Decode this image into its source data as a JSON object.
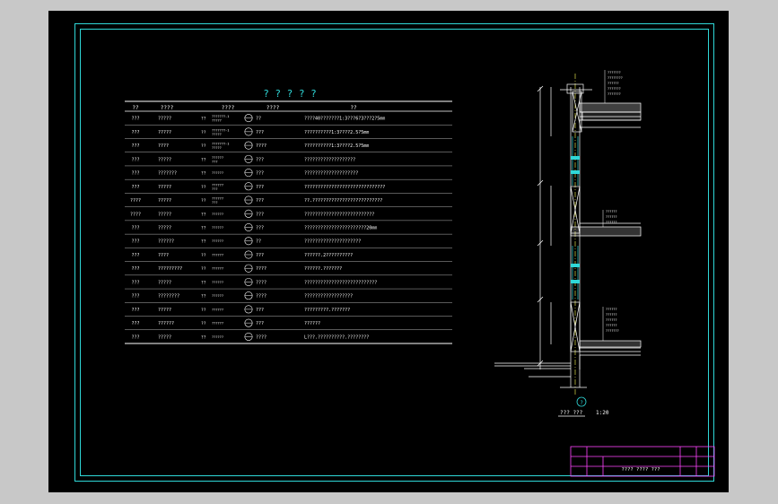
{
  "table": {
    "title": "? ? ? ? ?",
    "headers": [
      "??",
      "????",
      "????",
      "????",
      "??"
    ],
    "rows": [
      {
        "col1": "???",
        "col2": "?????",
        "code_prefix": "??",
        "ref_top": "???????-1",
        "ref_bot": "?????",
        "mark": "??",
        "desc": "????40???????1:3???6?3???2?5mm"
      },
      {
        "col1": "???",
        "col2": "?????",
        "code_prefix": "??",
        "ref_top": "???????-1",
        "ref_bot": "?????",
        "mark": "???",
        "desc": "??????????1:3????2.5?5mm"
      },
      {
        "col1": "???",
        "col2": "????",
        "code_prefix": "??",
        "ref_top": "???????-1",
        "ref_bot": "?????",
        "mark": "????",
        "desc": "??????????1:3????2.5?5mm"
      },
      {
        "col1": "???",
        "col2": "?????",
        "code_prefix": "??",
        "ref_top": "??????",
        "ref_bot": "???",
        "mark": "???",
        "desc": "???????????????????"
      },
      {
        "col1": "???",
        "col2": "???????",
        "code_prefix": "??",
        "ref_top": "??????",
        "ref_bot": "",
        "mark": "???",
        "desc": "????????????????????"
      },
      {
        "col1": "???",
        "col2": "?????",
        "code_prefix": "??",
        "ref_top": "??????",
        "ref_bot": "???",
        "mark": "???",
        "desc": "??????????????????????????????"
      },
      {
        "col1": "????",
        "col2": "?????",
        "code_prefix": "??",
        "ref_top": "??????",
        "ref_bot": "???",
        "mark": "???",
        "desc": "??.??????????????????????????"
      },
      {
        "col1": "????",
        "col2": "?????",
        "code_prefix": "??",
        "ref_top": "??????",
        "ref_bot": "",
        "mark": "???",
        "desc": "??????????????????????????"
      },
      {
        "col1": "???",
        "col2": "?????",
        "code_prefix": "??",
        "ref_top": "??????",
        "ref_bot": "",
        "mark": "???",
        "desc": "???????????????????????20mm"
      },
      {
        "col1": "???",
        "col2": "??????",
        "code_prefix": "??",
        "ref_top": "??????",
        "ref_bot": "",
        "mark": "??",
        "desc": "?????????????????????"
      },
      {
        "col1": "???",
        "col2": "????",
        "code_prefix": "??",
        "ref_top": "??????",
        "ref_bot": "",
        "mark": "???",
        "desc": "??????.2??????????"
      },
      {
        "col1": "???",
        "col2": "?????????",
        "code_prefix": "??",
        "ref_top": "??????",
        "ref_bot": "",
        "mark": "????",
        "desc": "??????.???????"
      },
      {
        "col1": "???",
        "col2": "?????",
        "code_prefix": "??",
        "ref_top": "??????",
        "ref_bot": "",
        "mark": "????",
        "desc": "???????????????????????????"
      },
      {
        "col1": "???",
        "col2": "????????",
        "code_prefix": "??",
        "ref_top": "??????",
        "ref_bot": "",
        "mark": "????",
        "desc": "??????????????????"
      },
      {
        "col1": "???",
        "col2": "?????",
        "code_prefix": "??",
        "ref_top": "??????",
        "ref_bot": "",
        "mark": "???",
        "desc": "?????????.???????"
      },
      {
        "col1": "???",
        "col2": "??????",
        "code_prefix": "??",
        "ref_top": "??????",
        "ref_bot": "",
        "mark": "???",
        "desc": "??????"
      },
      {
        "col1": "???",
        "col2": "?????",
        "code_prefix": "??",
        "ref_top": "??????",
        "ref_bot": "",
        "mark": "????",
        "desc": "L???.??????????.????????"
      }
    ]
  },
  "section": {
    "label": "??? ???",
    "scale": "1:20",
    "axis_mark": "?",
    "roof_notes": [
      "???????",
      "????????",
      "??????",
      "???????",
      "???????"
    ],
    "floor_notes": [
      "??????",
      "??????",
      "??????"
    ],
    "ground_notes": [
      "??????",
      "??????",
      "??????",
      "??????",
      "???????"
    ]
  },
  "title_block": {
    "drawing_name": "???? ???? ???"
  },
  "colors": {
    "background": "#000000",
    "frame": "#2fd8d8",
    "line": "#ffffff",
    "title_block": "#ff44ff",
    "accent": "#ffff55"
  }
}
